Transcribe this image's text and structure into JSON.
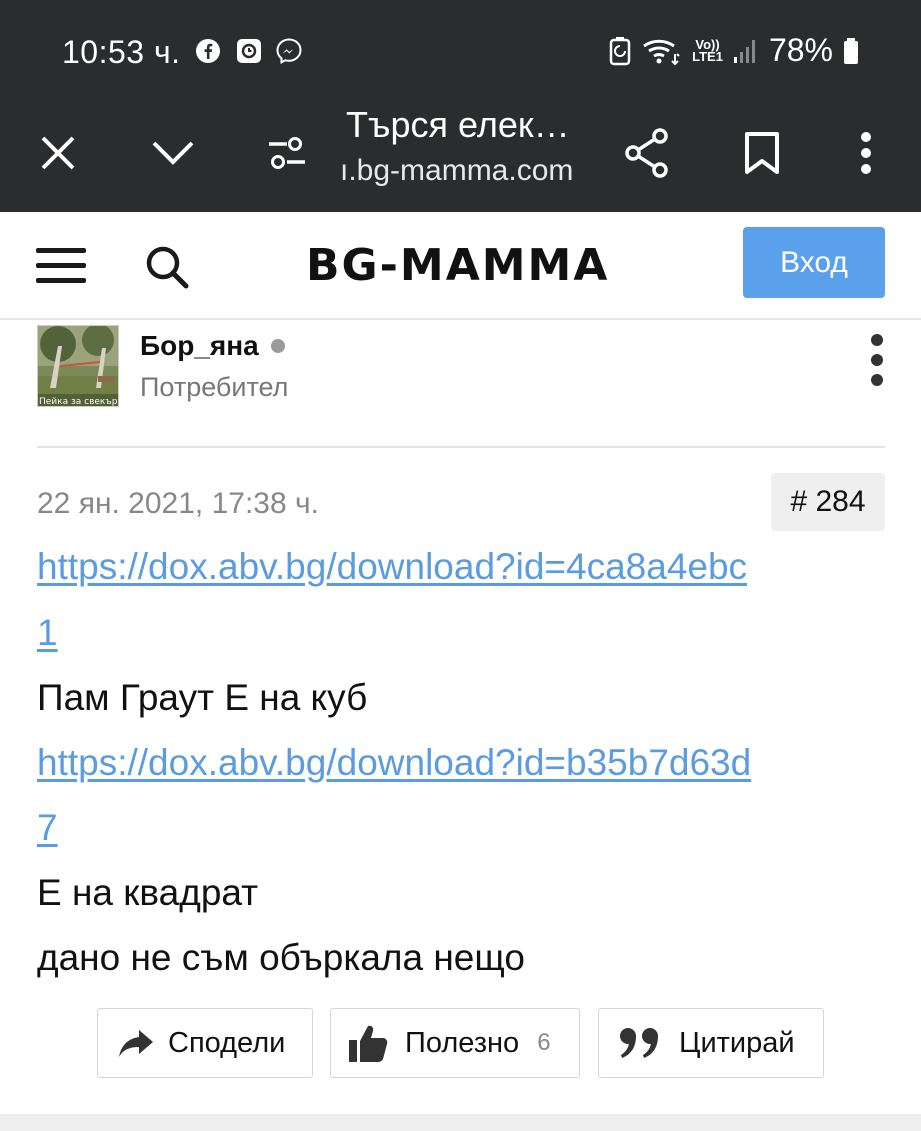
{
  "status_bar": {
    "time": "10:53 ч.",
    "battery": "78%",
    "network": "LTE1",
    "volte": "Vo))",
    "icons": [
      "facebook-icon",
      "clock-app-icon",
      "messenger-icon",
      "battery-saver-icon",
      "wifi-icon",
      "signal-icon",
      "battery-icon"
    ]
  },
  "browser": {
    "title": "Търся елек…",
    "url": "ı.bg-mamma.com",
    "buttons": [
      "close-icon",
      "chevron-down-icon",
      "page-settings-icon",
      "share-icon",
      "bookmark-icon",
      "more-vert-icon"
    ]
  },
  "site": {
    "logo": "BG-MAMMA",
    "login_label": "Вход",
    "accent": "#5aa0ea"
  },
  "post": {
    "avatar_caption": "Пейка за свекърви",
    "username": "Бор_яна",
    "role": "Потребител",
    "date": "22 ян. 2021, 17:38 ч.",
    "number": "# 284",
    "lines": [
      "https://dox.abv.bg/download?id=4ca8a4ebc",
      "1",
      "Пам Граут Е на куб",
      "https://dox.abv.bg/download?id=b35b7d63d",
      "7",
      "Е на квадрат",
      "дано не съм объркала нещо"
    ],
    "link_color": "#5b9be0"
  },
  "actions": {
    "share_label": "Сподели",
    "useful_label": "Полезно",
    "useful_count": "6",
    "quote_label": "Цитирай"
  }
}
